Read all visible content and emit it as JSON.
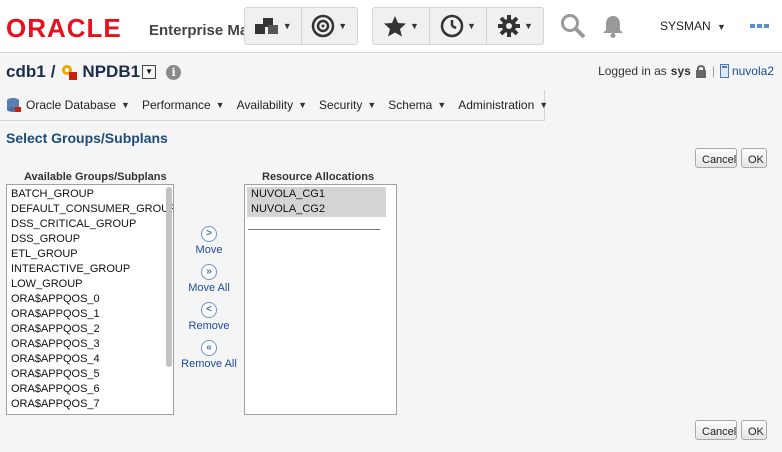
{
  "brand": {
    "logo": "ORACLE",
    "product": "Enterprise Manager Cloud Control"
  },
  "toolbar": {
    "user": "SYSMAN"
  },
  "header": {
    "cdb": "cdb1",
    "separator": "/",
    "pdb": "NPDB1",
    "logged_in_as_label": "Logged in as",
    "user": "sys",
    "separator2": "|",
    "host": "nuvola2"
  },
  "menu": {
    "items": [
      {
        "label": "Oracle Database"
      },
      {
        "label": "Performance"
      },
      {
        "label": "Availability"
      },
      {
        "label": "Security"
      },
      {
        "label": "Schema"
      },
      {
        "label": "Administration"
      }
    ]
  },
  "page": {
    "title": "Select Groups/Subplans",
    "cancel_label": "Cancel",
    "ok_label": "OK"
  },
  "available": {
    "label": "Available Groups/Subplans",
    "items": [
      "BATCH_GROUP",
      "DEFAULT_CONSUMER_GROUP",
      "DSS_CRITICAL_GROUP",
      "DSS_GROUP",
      "ETL_GROUP",
      "INTERACTIVE_GROUP",
      "LOW_GROUP",
      "ORA$APPQOS_0",
      "ORA$APPQOS_1",
      "ORA$APPQOS_2",
      "ORA$APPQOS_3",
      "ORA$APPQOS_4",
      "ORA$APPQOS_5",
      "ORA$APPQOS_6",
      "ORA$APPQOS_7"
    ]
  },
  "allocations": {
    "label": "Resource Allocations",
    "items": [
      "NUVOLA_CG1",
      "NUVOLA_CG2"
    ]
  },
  "movers": {
    "move": "Move",
    "move_all": "Move All",
    "remove": "Remove",
    "remove_all": "Remove All"
  }
}
